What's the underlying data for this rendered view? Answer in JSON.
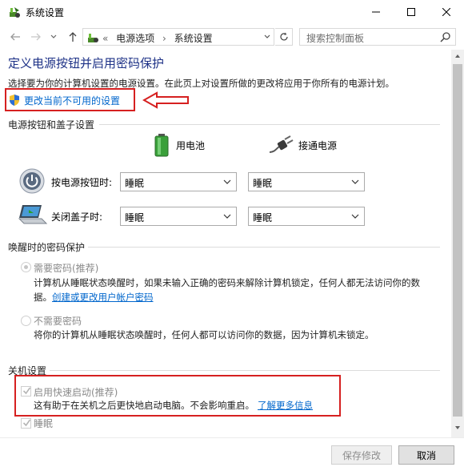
{
  "window": {
    "title": "系统设置"
  },
  "address": {
    "overflow": "«",
    "segments": [
      "电源选项",
      "系统设置"
    ],
    "separator": "›"
  },
  "search": {
    "placeholder": "搜索控制面板"
  },
  "header": {
    "title": "定义电源按钮并启用密码保护",
    "description": "选择要为你的计算机设置的电源设置。在此页上对设置所做的更改将应用于你所有的电源计划。",
    "unavailable_link": "更改当前不可用的设置"
  },
  "power_buttons": {
    "group_label": "电源按钮和盖子设置",
    "columns": [
      "用电池",
      "接通电源"
    ],
    "rows": [
      {
        "label": "按电源按钮时:",
        "battery": "睡眠",
        "plugged": "睡眠"
      },
      {
        "label": "关闭盖子时:",
        "battery": "睡眠",
        "plugged": "睡眠"
      }
    ]
  },
  "wake_password": {
    "group_label": "唤醒时的密码保护",
    "require": {
      "label": "需要密码(推荐)",
      "desc_line1": "计算机从睡眠状态唤醒时，如果未输入正确的密码来解除计算机锁定，任何人都无法访问你的数",
      "desc_line2_prefix": "据。",
      "desc_link": "创建或更改用户帐户密码"
    },
    "no_require": {
      "label": "不需要密码",
      "desc": "将你的计算机从睡眠状态唤醒时，任何人都可以访问你的数据，因为计算机未锁定。"
    }
  },
  "shutdown": {
    "group_label": "关机设置",
    "fast_startup": {
      "label": "启用快速启动(推荐)",
      "desc": "这有助于在关机之后更快地启动电脑。不会影响重启。",
      "link": "了解更多信息"
    },
    "sleep": {
      "label": "睡眠"
    }
  },
  "footer": {
    "save_label": "保存修改",
    "cancel_label": "取消"
  },
  "colors": {
    "accent": "#1e3287",
    "link": "#0066cc",
    "highlight": "#d62020"
  }
}
